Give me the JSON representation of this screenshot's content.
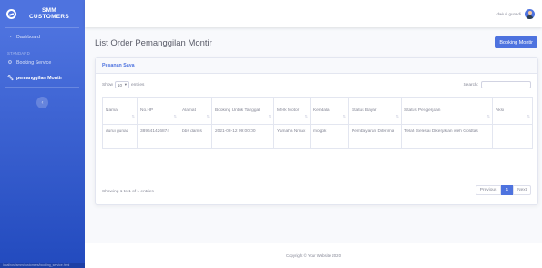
{
  "sidebar": {
    "brand": "SMM\nCUSTOMERS",
    "dashboard": "Dashboard",
    "heading": "STANDARD",
    "booking_service": "Booking Service",
    "pemanggilan": "pemanggilan Montir",
    "footer_text": "localhost/smm/customers/booking_service.html"
  },
  "topbar": {
    "user_name": "dwiuri gunadi"
  },
  "page": {
    "title": "List Order Pemanggilan Montir",
    "booking_button": "Booking Montir"
  },
  "card": {
    "title": "Pesanan Saya",
    "show_label": "Show",
    "show_value": "10",
    "entries_label": "entries",
    "search_label": "Search:",
    "info": "Showing 1 to 1 of 1 entries",
    "prev": "Previous",
    "page": "1",
    "next": "Next"
  },
  "table": {
    "headers": [
      "Nama",
      "No.HP",
      "Alamat",
      "Booking Untuk Tanggal",
      "Merk Motor",
      "Kendala",
      "Status Bayar",
      "Status Pengerjaan",
      "Aksi"
    ],
    "rows": [
      [
        "durui gunad",
        "389641426874",
        "bbs damis",
        "2021-08-12 09:00:00",
        "Yamaha Nmax",
        "mogok",
        "Pembayaran Diterima",
        "Telah Selesai Dikerjakan oleh Goldtas",
        ""
      ]
    ]
  },
  "footer": {
    "text": "Copyright © Your Website 2020"
  }
}
